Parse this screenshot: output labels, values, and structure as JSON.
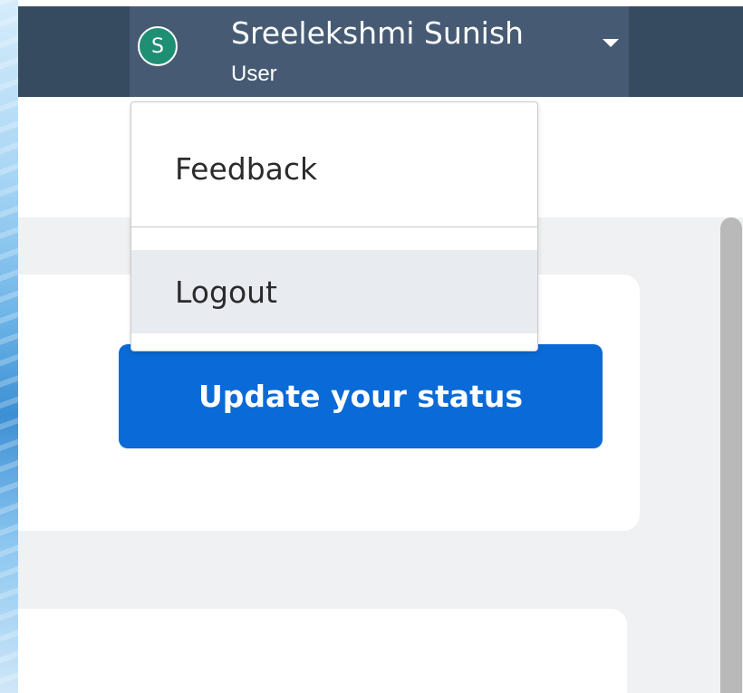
{
  "header": {
    "user": {
      "initial": "S",
      "name": "Sreelekshmi Sunish",
      "role": "User"
    },
    "caret_icon": "caret-down-icon"
  },
  "dropdown": {
    "items": [
      {
        "label": "Feedback"
      },
      {
        "label": "Logout",
        "highlighted": true
      }
    ]
  },
  "main": {
    "update_status_label": "Update your status"
  },
  "colors": {
    "header_bg": "#364a60",
    "user_menu_bg": "#465b73",
    "avatar_bg": "#1f8f74",
    "primary_button": "#0a6ad7",
    "content_bg": "#f0f1f2",
    "highlight_bg": "#e8ebef"
  }
}
